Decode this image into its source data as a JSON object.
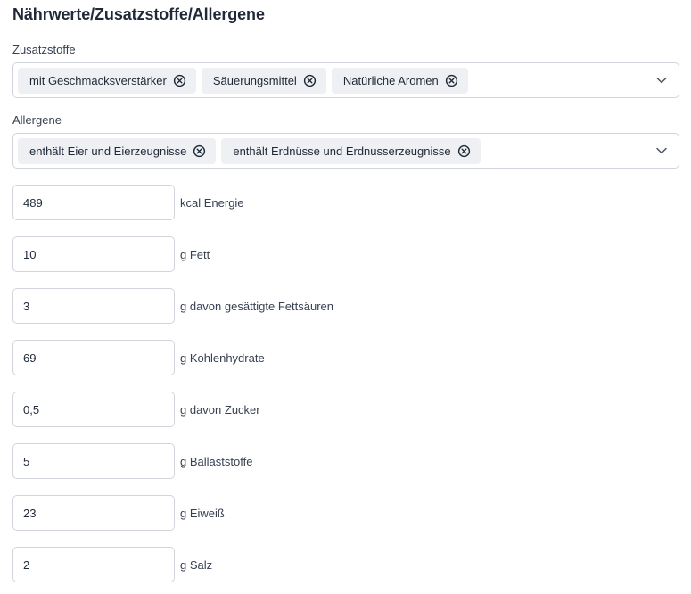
{
  "title": "Nährwerte/Zusatzstoffe/Allergene",
  "zusatzstoffe": {
    "label": "Zusatzstoffe",
    "chips": [
      "mit Geschmacksverstärker",
      "Säuerungsmittel",
      "Natürliche Aromen"
    ]
  },
  "allergene": {
    "label": "Allergene",
    "chips": [
      "enthält Eier und Eierzeugnisse",
      "enthält Erdnüsse und Erdnusserzeugnisse"
    ]
  },
  "nutrients": [
    {
      "value": "489",
      "label": "kcal Energie"
    },
    {
      "value": "10",
      "label": "g Fett"
    },
    {
      "value": "3",
      "label": "g davon gesättigte Fettsäuren"
    },
    {
      "value": "69",
      "label": "g Kohlenhydrate"
    },
    {
      "value": "0,5",
      "label": "g davon Zucker"
    },
    {
      "value": "5",
      "label": "g Ballaststoffe"
    },
    {
      "value": "23",
      "label": "g Eiweiß"
    },
    {
      "value": "2",
      "label": "g Salz"
    }
  ]
}
